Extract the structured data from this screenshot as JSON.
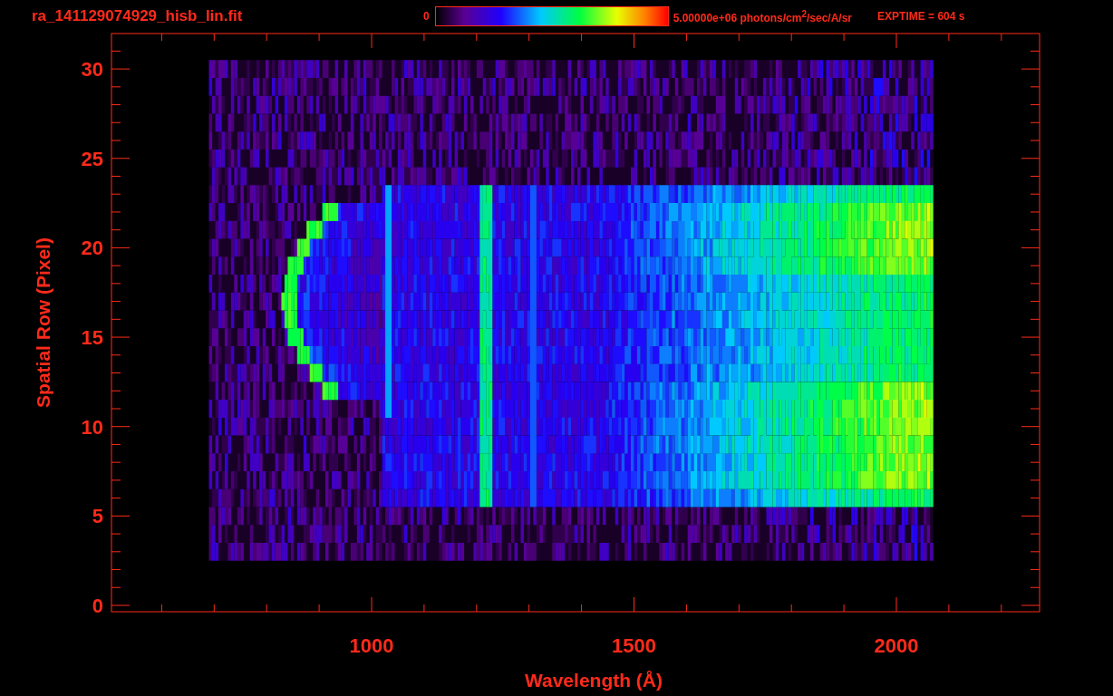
{
  "header": {
    "title": "ra_141129074929_hisb_lin.fit",
    "colorbar_min": "0",
    "colorbar_max": "5.00000e+06 photons/cm$^{2}$/sec/A/sr",
    "exposure": "EXPTIME = 604 s"
  },
  "plot": {
    "xlabel": "Wavelength (Å)",
    "ylabel": "Spatial Row (Pixel)",
    "xtick_labels": [
      "1000",
      "1500",
      "2000"
    ],
    "ytick_labels": [
      "30",
      "25",
      "20",
      "15",
      "10",
      "5",
      "0"
    ]
  }
}
